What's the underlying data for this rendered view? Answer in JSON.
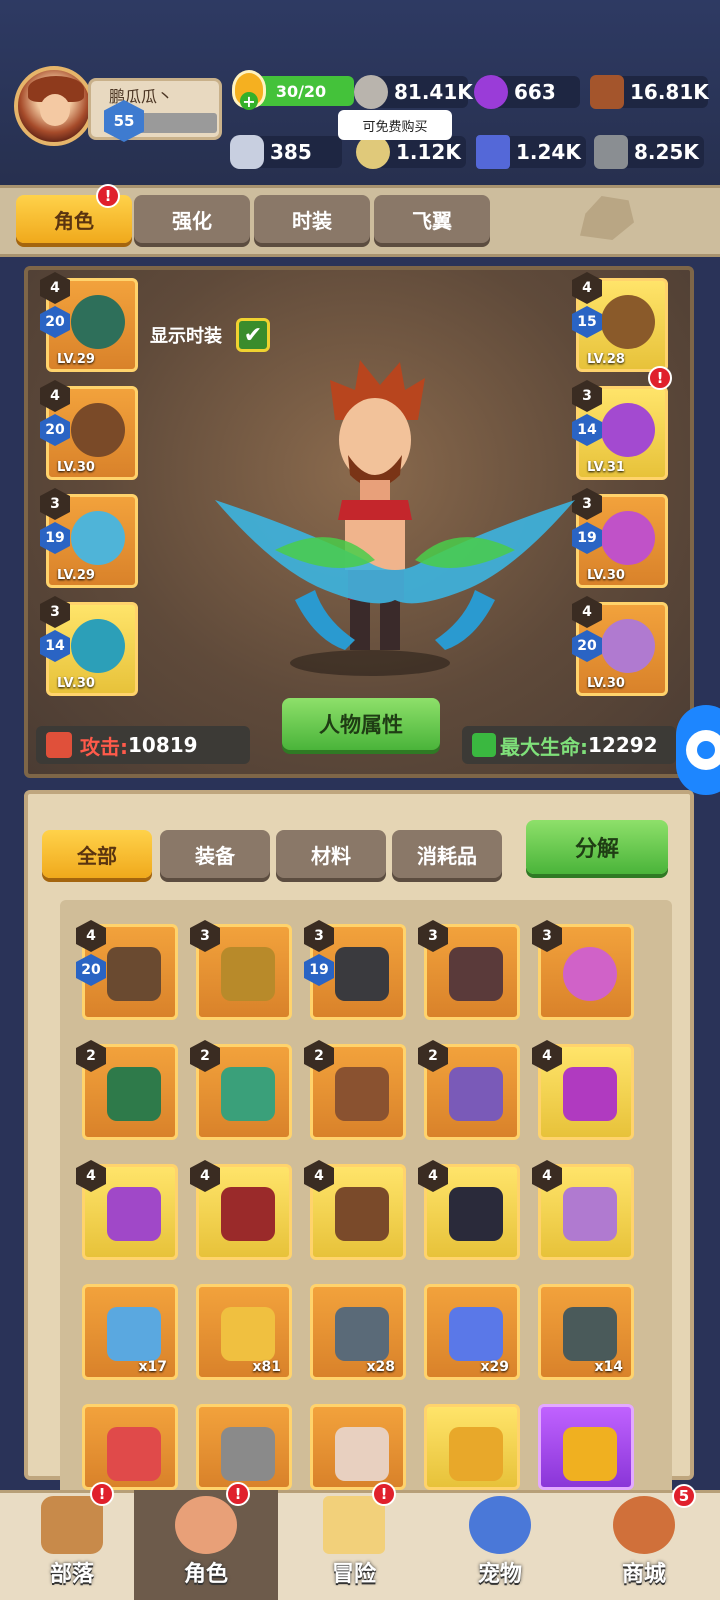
{
  "player": {
    "name": "鹏瓜瓜丶",
    "level": "55"
  },
  "resources": {
    "energy": "30/20",
    "stone": "81.41K",
    "gem_purple": "663",
    "wood": "16.81K",
    "bone": "385",
    "coin": "1.12K",
    "crystal": "1.24K",
    "ore": "8.25K"
  },
  "tooltip": "可免费购买",
  "tabs": [
    "角色",
    "强化",
    "时装",
    "飞翼"
  ],
  "show_costume_label": "显示时装",
  "left_slots": [
    {
      "star": "4",
      "lvnum": "20",
      "lv": "LV.29"
    },
    {
      "star": "4",
      "lvnum": "20",
      "lv": "LV.30"
    },
    {
      "star": "3",
      "lvnum": "19",
      "lv": "LV.29"
    },
    {
      "star": "3",
      "lvnum": "14",
      "lv": "LV.30"
    }
  ],
  "right_slots": [
    {
      "star": "4",
      "lvnum": "15",
      "lv": "LV.28"
    },
    {
      "star": "3",
      "lvnum": "14",
      "lv": "LV.31"
    },
    {
      "star": "3",
      "lvnum": "19",
      "lv": "LV.30"
    },
    {
      "star": "4",
      "lvnum": "20",
      "lv": "LV.30"
    }
  ],
  "attr_button": "人物属性",
  "attack_label": "攻击:",
  "attack_value": "10819",
  "hp_label": "最大生命:",
  "hp_value": "12292",
  "inv_tabs": [
    "全部",
    "装备",
    "材料",
    "消耗品"
  ],
  "decompose": "分解",
  "items_row1": [
    {
      "star": "4",
      "lvnum": "20"
    },
    {
      "star": "3"
    },
    {
      "star": "3",
      "lvnum": "19"
    },
    {
      "star": "3"
    },
    {
      "star": "3"
    }
  ],
  "items_row2": [
    "2",
    "2",
    "2",
    "2",
    "4"
  ],
  "items_row3": [
    "4",
    "4",
    "4",
    "4",
    "4"
  ],
  "items_row4": [
    "x17",
    "x81",
    "x28",
    "x29",
    "x14"
  ],
  "nav": [
    "部落",
    "角色",
    "冒险",
    "宠物",
    "商城"
  ],
  "nav_badge_shop": "5",
  "colors": {
    "accent_gold": "#f0a91c",
    "green_button": "#4ab43a",
    "badge_red": "#e0202c"
  }
}
